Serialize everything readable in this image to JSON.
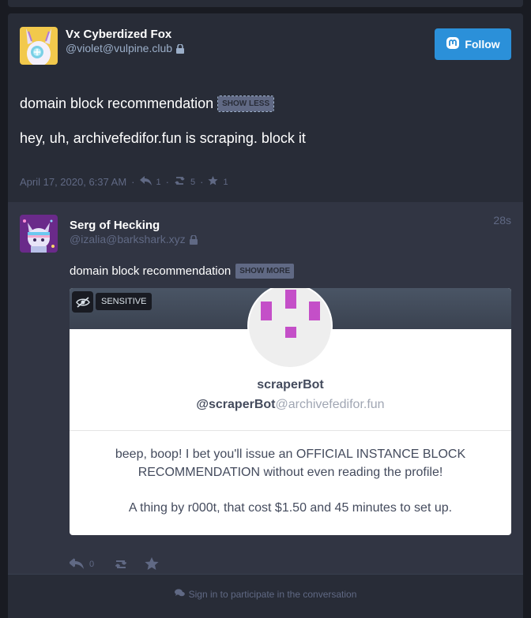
{
  "main_status": {
    "display_name": "Vx Cyberdized Fox",
    "acct": "@violet@vulpine.club",
    "follow_label": "Follow",
    "spoiler_text": "domain block recommendation",
    "toggle_label": "SHOW LESS",
    "content": "hey, uh, archivefedifor.fun is scraping. block it",
    "timestamp": "April 17, 2020, 6:37 AM",
    "reply_count": "1",
    "boost_count": "5",
    "fav_count": "1"
  },
  "reply_status": {
    "display_name": "Serg of Hecking",
    "acct": "@izalia@barkshark.xyz",
    "relative_time": "28s",
    "spoiler_text": "domain block recommendation",
    "toggle_label": "SHOW MORE",
    "sensitive_label": "SENSITIVE",
    "reply_count": "0"
  },
  "media_card": {
    "bot_name": "scraperBot",
    "bot_handle_user": "@scraperBot",
    "bot_handle_domain": "@archivefedifor.fun",
    "bio_line1": "beep, boop! I bet you'll issue an OFFICIAL INSTANCE BLOCK RECOMMENDATION without even reading the profile!",
    "bio_line2": "A thing by r000t, that cost $1.50 and 45 minutes to set up."
  },
  "footer": {
    "signin_text": "Sign in to participate in the conversation"
  },
  "colors": {
    "background": "#191b22",
    "card": "#282c37",
    "reply_bg": "#313543",
    "accent": "#2b90d9",
    "muted": "#606984",
    "secondary": "#9baec8",
    "bot_purple": "#c44fc8"
  }
}
